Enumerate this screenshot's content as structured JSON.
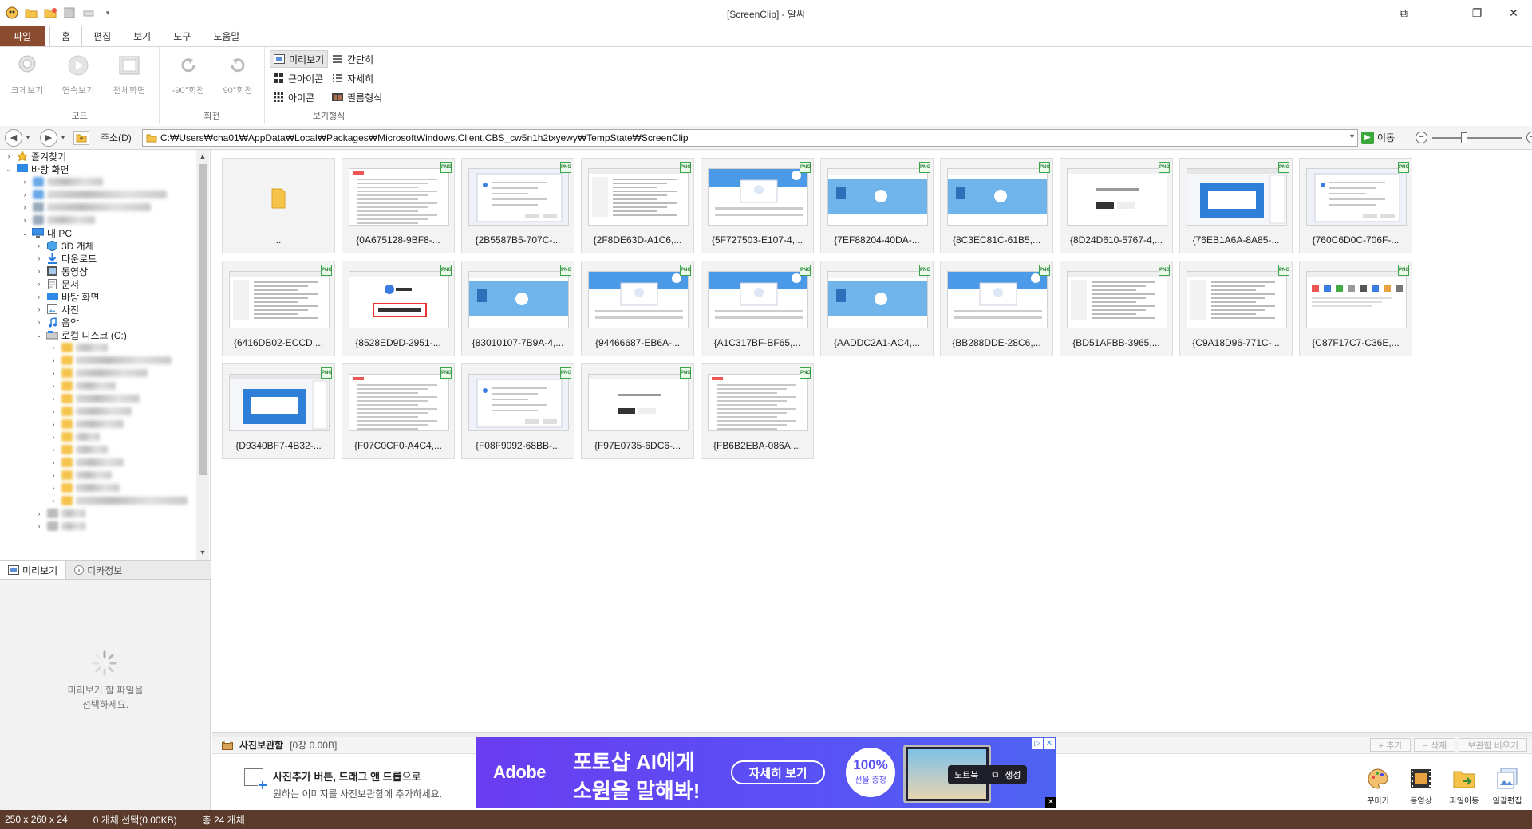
{
  "window": {
    "title": "[ScreenClip] - 알씨",
    "controls": [
      "restore-icon",
      "minimize-icon",
      "maximize-icon",
      "close-icon"
    ]
  },
  "menu": {
    "file": "파일",
    "tabs": [
      "홈",
      "편집",
      "보기",
      "도구",
      "도움말"
    ],
    "active_tab": "홈"
  },
  "ribbon": {
    "mode": {
      "label": "모드",
      "buttons": [
        "크게보기",
        "연속보기",
        "전체화면"
      ]
    },
    "rotate": {
      "label": "회전",
      "buttons": [
        "-90°회전",
        "90°회전"
      ]
    },
    "view": {
      "label": "보기형식",
      "buttons": [
        "미리보기",
        "간단히",
        "큰아이콘",
        "자세히",
        "아이콘",
        "필름형식"
      ],
      "selected": "미리보기"
    }
  },
  "address": {
    "label": "주소(D)",
    "path": "C:₩Users₩cha01₩AppData₩Local₩Packages₩MicrosoftWindows.Client.CBS_cw5n1h2txyewy₩TempState₩ScreenClip",
    "go_label": "이동",
    "zoom": {
      "minus": "−",
      "plus": "+",
      "level": 0.35
    }
  },
  "tree": {
    "favorites": "즐겨찾기",
    "desktop": "바탕 화면",
    "mypc": "내 PC",
    "mypc_items": [
      "3D 개체",
      "다운로드",
      "동영상",
      "문서",
      "바탕 화면",
      "사진",
      "음악",
      "로컬 디스크 (C:)"
    ]
  },
  "preview": {
    "tabs": [
      "미리보기",
      "디카정보"
    ],
    "message_line1": "미리보기 할 파일을",
    "message_line2": "선택하세요."
  },
  "thumbnails": [
    {
      "name": "..",
      "kind": "folder"
    },
    {
      "name": "{0A675128-9BF8-...",
      "kind": "doc"
    },
    {
      "name": "{2B5587B5-707C-...",
      "kind": "dialog"
    },
    {
      "name": "{2F8DE63D-A1C6,...",
      "kind": "list"
    },
    {
      "name": "{5F727503-E107-4,...",
      "kind": "web"
    },
    {
      "name": "{7EF88204-40DA-...",
      "kind": "blue"
    },
    {
      "name": "{8C3EC81C-61B5,...",
      "kind": "blue"
    },
    {
      "name": "{8D24D610-5767-4,...",
      "kind": "modal"
    },
    {
      "name": "{76EB1A6A-8A85-...",
      "kind": "bluepanel"
    },
    {
      "name": "{760C6D0C-706F-...",
      "kind": "dialog"
    },
    {
      "name": "{6416DB02-ECCD,...",
      "kind": "list"
    },
    {
      "name": "{8528ED9D-2951-...",
      "kind": "redbox"
    },
    {
      "name": "{83010107-7B9A-4,...",
      "kind": "blue"
    },
    {
      "name": "{94466687-EB6A-...",
      "kind": "web"
    },
    {
      "name": "{A1C317BF-BF65,...",
      "kind": "web"
    },
    {
      "name": "{AADDC2A1-AC4,...",
      "kind": "blue"
    },
    {
      "name": "{BB288DDE-28C6,...",
      "kind": "web"
    },
    {
      "name": "{BD51AFBB-3965,...",
      "kind": "list"
    },
    {
      "name": "{C9A18D96-771C-...",
      "kind": "list"
    },
    {
      "name": "{C87F17C7-C36E,...",
      "kind": "icons"
    },
    {
      "name": "{D9340BF7-4B32-...",
      "kind": "bluepanel"
    },
    {
      "name": "{F07C0CF0-A4C4,...",
      "kind": "doc"
    },
    {
      "name": "{F08F9092-68BB-...",
      "kind": "dialog"
    },
    {
      "name": "{F97E0735-6DC6-...",
      "kind": "modal"
    },
    {
      "name": "{FB6B2EBA-086A,...",
      "kind": "doc"
    }
  ],
  "photobox": {
    "title": "사진보관함",
    "count": "[0장 0.00B]",
    "buttons": [
      "+ 추가",
      "− 삭제",
      "보관함 비우기"
    ],
    "hint_bold": "사진추가 버튼, 드래그 앤 드롭",
    "hint_suffix": "으로",
    "hint_line2": "원하는 이미지를 사진보관함에 추가하세요."
  },
  "ad": {
    "brand": "Adobe",
    "headline1": "포토샵 AI에게",
    "headline2": "소원을 말해봐!",
    "cta": "자세히 보기",
    "seal_pct": "100%",
    "seal_text": "선물 증정",
    "pill_left": "노트북",
    "pill_right": "생성"
  },
  "tools": [
    "꾸미기",
    "동영상",
    "파일이동",
    "일괄편집"
  ],
  "status": {
    "size": "250 x 260 x 24",
    "selected": "0 개체 선택(0.00KB)",
    "total": "총 24 개체"
  },
  "colors": {
    "file_tab": "#8a4b2e",
    "statusbar": "#5a3a2a",
    "ad_bg": "#5b4ef4"
  }
}
